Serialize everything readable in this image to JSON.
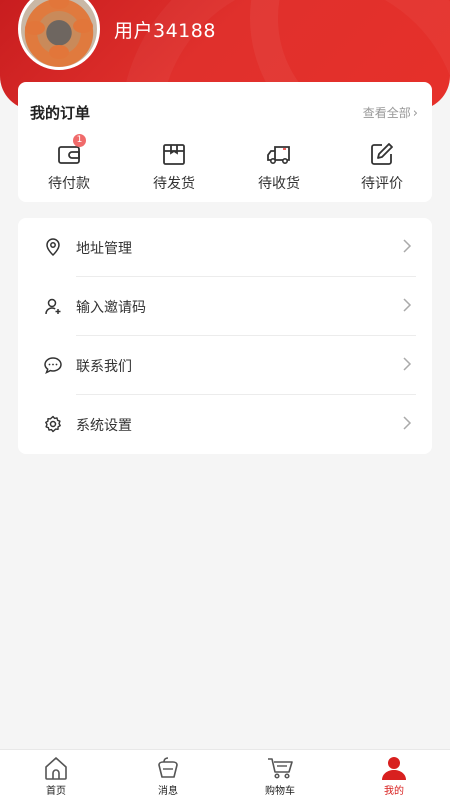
{
  "profile": {
    "username": "用户34188"
  },
  "orders": {
    "title": "我的订单",
    "view_all": "查看全部",
    "items": [
      {
        "label": "待付款",
        "icon": "wallet-icon",
        "badge": "1"
      },
      {
        "label": "待发货",
        "icon": "package-icon"
      },
      {
        "label": "待收货",
        "icon": "truck-icon"
      },
      {
        "label": "待评价",
        "icon": "edit-icon"
      }
    ]
  },
  "menu": {
    "items": [
      {
        "label": "地址管理",
        "icon": "location-pin-icon"
      },
      {
        "label": "输入邀请码",
        "icon": "user-add-icon"
      },
      {
        "label": "联系我们",
        "icon": "chat-icon"
      },
      {
        "label": "系统设置",
        "icon": "gear-icon"
      }
    ]
  },
  "tabbar": {
    "items": [
      {
        "label": "首页",
        "icon": "home-icon"
      },
      {
        "label": "消息",
        "icon": "message-icon"
      },
      {
        "label": "购物车",
        "icon": "cart-icon"
      },
      {
        "label": "我的",
        "icon": "profile-icon",
        "active": true
      }
    ]
  },
  "colors": {
    "brand": "#d8201f",
    "badge": "#f06a6a"
  }
}
